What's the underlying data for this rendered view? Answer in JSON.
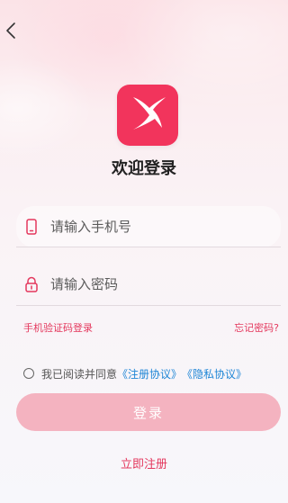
{
  "header": {
    "back_icon": "chevron-left-icon"
  },
  "logo": {
    "icon": "x-mark-logo-icon",
    "bg_color": "#f2345c"
  },
  "page_title": "欢迎登录",
  "phone_field": {
    "icon": "phone-icon",
    "placeholder": "请输入手机号",
    "value": ""
  },
  "password_field": {
    "icon": "lock-icon",
    "placeholder": "请输入密码",
    "value": ""
  },
  "links": {
    "sms_login": "手机验证码登录",
    "forgot_password": "忘记密码?"
  },
  "agreement": {
    "prefix": "我已阅读并同意",
    "register_agreement": "《注册协议》",
    "privacy_agreement": "《隐私协议》",
    "checked": false
  },
  "login_button": {
    "label": "登录",
    "color": "#f4b3c0"
  },
  "register_link": "立即注册",
  "colors": {
    "accent": "#e4375d",
    "link_blue": "#1f86d6"
  }
}
